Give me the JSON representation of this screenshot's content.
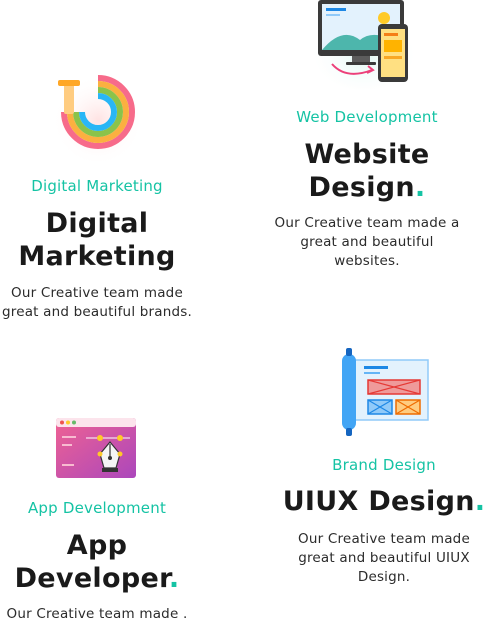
{
  "services": {
    "digital_marketing": {
      "tag": "Digital Marketing",
      "title_line1": "Digital",
      "title_line2": "Marketing",
      "title_suffix": "",
      "desc_line1": "Our Creative team made",
      "desc_line2": "great and beautiful brands.",
      "icon": "rainbow-target-icon"
    },
    "website_design": {
      "tag": "Web Development",
      "title_line1": "Website",
      "title_line2": "Design",
      "title_suffix": ".",
      "desc_line1": "Our Creative team made a",
      "desc_line2": "great and beautiful",
      "desc_line3": "websites.",
      "icon": "responsive-devices-icon"
    },
    "uiux_design": {
      "tag": "Brand Design",
      "title_line1": "UIUX Design",
      "title_suffix": ".",
      "desc_line1": "Our Creative team made",
      "desc_line2": "great and beautiful UIUX",
      "desc_line3": "Design.",
      "icon": "wireframe-blueprint-icon"
    },
    "app_developer": {
      "tag": "App Development",
      "title_line1": "App",
      "title_line2": "Developer",
      "title_suffix": ".",
      "desc_line1": "Our Creative team made .",
      "icon": "pen-tool-window-icon"
    }
  },
  "colors": {
    "accent": "#15c3a4",
    "heading": "#1a1a1a",
    "body_text": "#2b2b2b"
  }
}
